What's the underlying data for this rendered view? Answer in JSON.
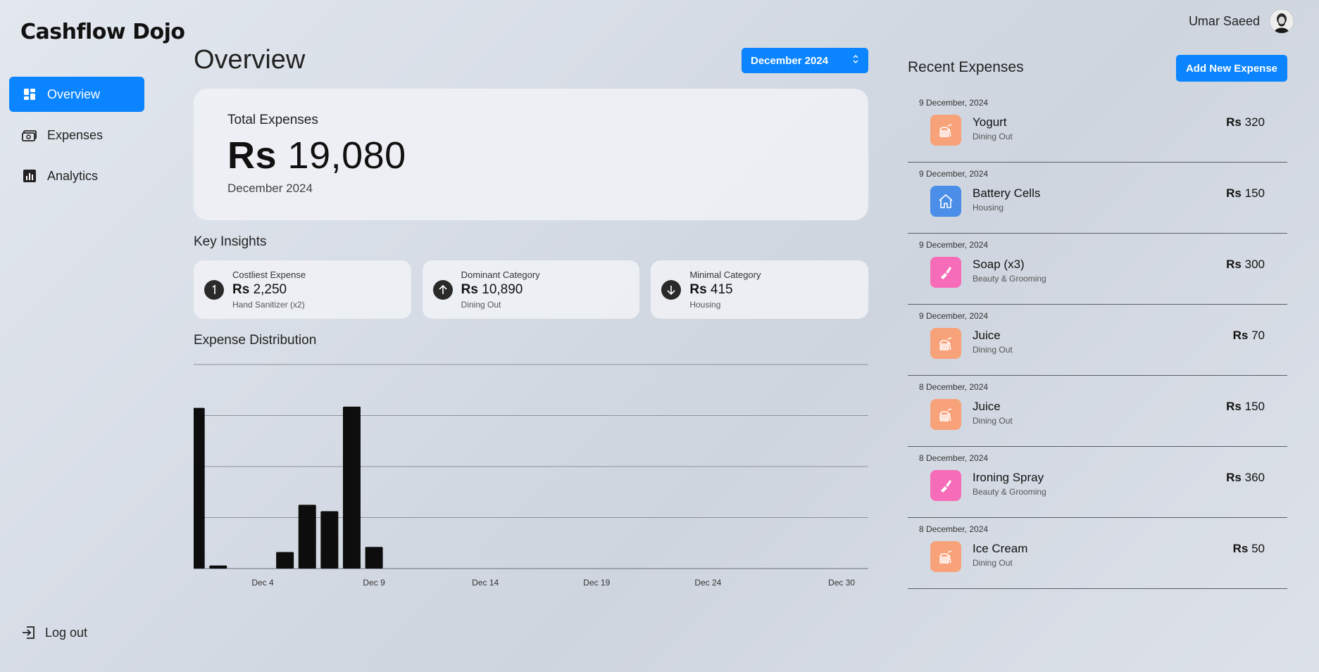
{
  "app": {
    "logo": "Cashflow Dojo"
  },
  "user": {
    "name": "Umar Saeed"
  },
  "sidebar": {
    "items": [
      {
        "label": "Overview",
        "icon": "dashboard-icon",
        "active": true
      },
      {
        "label": "Expenses",
        "icon": "money-icon",
        "active": false
      },
      {
        "label": "Analytics",
        "icon": "bar-chart-icon",
        "active": false
      }
    ],
    "logout": "Log out"
  },
  "main": {
    "title": "Overview",
    "month_select": "December 2024",
    "total": {
      "label": "Total Expenses",
      "currency": "Rs",
      "amount": "19,080",
      "period": "December 2024"
    },
    "insights_title": "Key Insights",
    "insights": [
      {
        "label": "Costliest Expense",
        "currency": "Rs",
        "value": "2,250",
        "detail": "Hand Sanitizer (x2)",
        "icon": "exclamation-icon"
      },
      {
        "label": "Dominant Category",
        "currency": "Rs",
        "value": "10,890",
        "detail": "Dining Out",
        "icon": "arrow-up-icon"
      },
      {
        "label": "Minimal Category",
        "currency": "Rs",
        "value": "415",
        "detail": "Housing",
        "icon": "arrow-down-icon"
      }
    ],
    "distribution_title": "Expense Distribution"
  },
  "chart_data": {
    "type": "bar",
    "title": "Expense Distribution",
    "xlabel": "",
    "ylabel": "",
    "x_ticks": [
      "Dec 4",
      "Dec 9",
      "Dec 14",
      "Dec 19",
      "Dec 24",
      "Dec 30"
    ],
    "tick_days": [
      4,
      9,
      14,
      19,
      24,
      30
    ],
    "days": [
      1,
      2,
      5,
      6,
      7,
      8,
      9
    ],
    "values": [
      6300,
      120,
      650,
      2500,
      2250,
      6350,
      850
    ],
    "ylim": [
      0,
      8000
    ],
    "grid": true,
    "bar_color": "#0d0d0d"
  },
  "recent": {
    "title": "Recent Expenses",
    "add_button": "Add New Expense",
    "items": [
      {
        "date": "9 December, 2024",
        "title": "Yogurt",
        "category": "Dining Out",
        "currency": "Rs",
        "amount": "320",
        "icon": "fastfood-icon",
        "color": "#f8a27a"
      },
      {
        "date": "9 December, 2024",
        "title": "Battery Cells",
        "category": "Housing",
        "currency": "Rs",
        "amount": "150",
        "icon": "home-icon",
        "color": "#4a8ee8"
      },
      {
        "date": "9 December, 2024",
        "title": "Soap (x3)",
        "category": "Beauty & Grooming",
        "currency": "Rs",
        "amount": "300",
        "icon": "lipstick-icon",
        "color": "#f76cb8"
      },
      {
        "date": "9 December, 2024",
        "title": "Juice",
        "category": "Dining Out",
        "currency": "Rs",
        "amount": "70",
        "icon": "fastfood-icon",
        "color": "#f8a27a"
      },
      {
        "date": "8 December, 2024",
        "title": "Juice",
        "category": "Dining Out",
        "currency": "Rs",
        "amount": "150",
        "icon": "fastfood-icon",
        "color": "#f8a27a"
      },
      {
        "date": "8 December, 2024",
        "title": "Ironing Spray",
        "category": "Beauty & Grooming",
        "currency": "Rs",
        "amount": "360",
        "icon": "lipstick-icon",
        "color": "#f76cb8"
      },
      {
        "date": "8 December, 2024",
        "title": "Ice Cream",
        "category": "Dining Out",
        "currency": "Rs",
        "amount": "50",
        "icon": "fastfood-icon",
        "color": "#f8a27a"
      }
    ]
  }
}
